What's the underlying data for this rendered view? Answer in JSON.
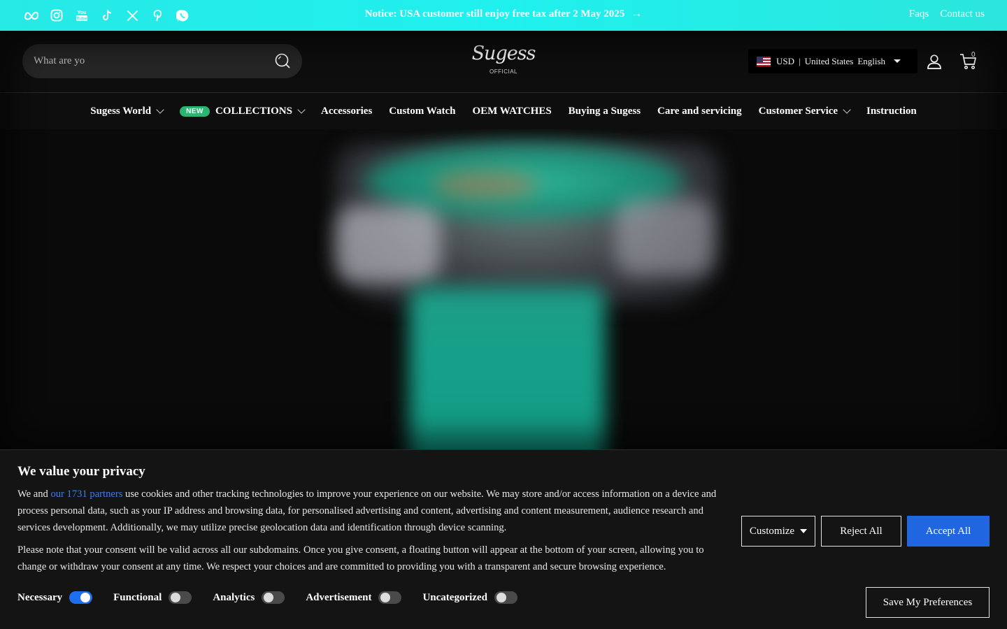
{
  "topbar": {
    "notice": "Notice: USA customer still enjoy free tax after 2 May 2025",
    "notice_arrow": "→",
    "links": [
      "Faqs",
      "Contact us"
    ],
    "socials": [
      "meta-icon",
      "instagram-icon",
      "youtube-icon",
      "tiktok-icon",
      "x-icon",
      "pinterest-icon",
      "whatsapp-icon"
    ]
  },
  "header": {
    "search_placeholder": "What are yo",
    "logo_text": "Sugess",
    "logo_sub": "OFFICIAL",
    "currency": "USD",
    "country": "United States",
    "language": "English",
    "separator": "|",
    "cart_count": "0"
  },
  "nav": {
    "items": [
      {
        "label": "Sugess World",
        "dropdown": true
      },
      {
        "label": "COLLECTIONS",
        "badge": "NEW",
        "dropdown": true
      },
      {
        "label": "Accessories"
      },
      {
        "label": "Custom Watch"
      },
      {
        "label": "OEM WATCHES"
      },
      {
        "label": "Buying a Sugess"
      },
      {
        "label": "Care and servicing"
      },
      {
        "label": "Customer Service",
        "dropdown": true
      },
      {
        "label": "Instruction"
      }
    ]
  },
  "cookie": {
    "title": "We value your privacy",
    "p1_before": "We and ",
    "p1_link": "our 1731 partners",
    "p1_after": " use cookies and other tracking technologies to improve your experience on our website. We may store and/or access information on a device and process personal data, such as your IP address and browsing data, for personalised advertising and content, advertising and content measurement, audience research and services development. Additionally, we may utilize precise geolocation data and identification through device scanning.",
    "p2": "Please note that your consent will be valid across all our subdomains. Once you give consent, a floating button will appear at the bottom of your screen, allowing you to change or withdraw your consent at any time. We respect your choices and are committed to providing you with a transparent and secure browsing experience.",
    "toggles": [
      {
        "label": "Necessary",
        "on": true
      },
      {
        "label": "Functional",
        "on": false
      },
      {
        "label": "Analytics",
        "on": false
      },
      {
        "label": "Advertisement",
        "on": false
      },
      {
        "label": "Uncategorized",
        "on": false
      }
    ],
    "customize_label": "Customize",
    "reject_label": "Reject All",
    "accept_label": "Accept All",
    "save_label": "Save My Preferences"
  },
  "colors": {
    "topbar": "#1ff0ee",
    "accept": "#1f66e0",
    "badge": "#2ab573",
    "link": "#3b7df0"
  }
}
